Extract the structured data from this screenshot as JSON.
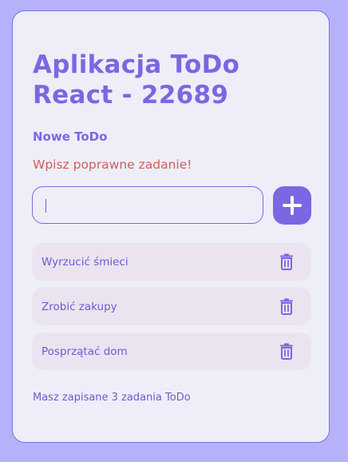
{
  "app": {
    "title": "Aplikacja ToDo React - 22689",
    "new_todo_label": "Nowe ToDo",
    "error_message": "Wpisz poprawne zadanie!",
    "input": {
      "value": "",
      "placeholder": ""
    },
    "add_button_icon": "plus-icon",
    "todos": [
      {
        "text": "Wyrzucić śmieci",
        "icon": "trash-icon"
      },
      {
        "text": "Zrobić zakupy",
        "icon": "trash-icon"
      },
      {
        "text": "Posprzątać dom",
        "icon": "trash-icon"
      }
    ],
    "footer_text": "Masz zapisane 3 zadania ToDo"
  },
  "colors": {
    "background": "#b6b1fb",
    "card": "#eeeef8",
    "accent": "#7b67e1",
    "error": "#cf5f5c",
    "todo_item_bg": "#ebe3ef"
  }
}
